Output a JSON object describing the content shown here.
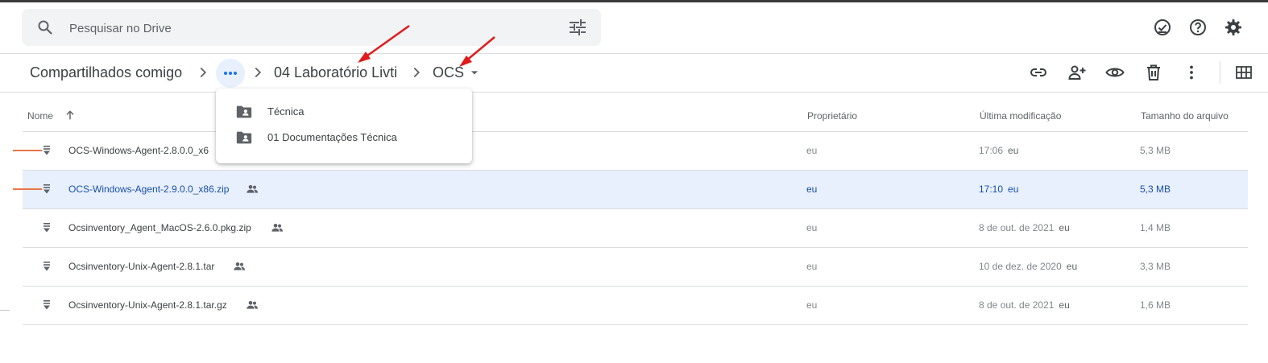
{
  "search": {
    "placeholder": "Pesquisar no Drive"
  },
  "top_icons": [
    "offline-status-icon",
    "help-icon",
    "settings-icon"
  ],
  "breadcrumb": {
    "items": [
      "Compartilhados comigo",
      "04 Laboratório Livti",
      "OCS"
    ],
    "more_icon": "more-horiz-icon",
    "dropdown_icon": "arrow-drop-down-icon"
  },
  "toolbar_icons": [
    "link-icon",
    "share-icon",
    "preview-icon",
    "trash-icon",
    "more-vert-icon",
    "grid-view-icon"
  ],
  "popup": {
    "items": [
      {
        "label": "Técnica",
        "icon": "shared-folder-icon"
      },
      {
        "label": "01 Documentações Técnica",
        "icon": "shared-folder-icon"
      }
    ]
  },
  "table": {
    "columns": {
      "name": "Nome",
      "owner": "Proprietário",
      "modified": "Última modificação",
      "size": "Tamanho do arquivo"
    },
    "sort_icon": "arrow-up-icon",
    "rows": [
      {
        "name": "OCS-Windows-Agent-2.8.0.0_x6",
        "owner": "eu",
        "modified": "17:06",
        "modified_by": "eu",
        "size": "5,3 MB",
        "selected": false,
        "shared": false
      },
      {
        "name": "OCS-Windows-Agent-2.9.0.0_x86.zip",
        "owner": "eu",
        "modified": "17:10",
        "modified_by": "eu",
        "size": "5,3 MB",
        "selected": true,
        "shared": true
      },
      {
        "name": "Ocsinventory_Agent_MacOS-2.6.0.pkg.zip",
        "owner": "eu",
        "modified": "8 de out. de 2021",
        "modified_by": "eu",
        "size": "1,4 MB",
        "selected": false,
        "shared": true
      },
      {
        "name": "Ocsinventory-Unix-Agent-2.8.1.tar",
        "owner": "eu",
        "modified": "10 de dez. de 2020",
        "modified_by": "eu",
        "size": "3,3 MB",
        "selected": false,
        "shared": true
      },
      {
        "name": "Ocsinventory-Unix-Agent-2.8.1.tar.gz",
        "owner": "eu",
        "modified": "8 de out. de 2021",
        "modified_by": "eu",
        "size": "1,6 MB",
        "selected": false,
        "shared": true
      }
    ]
  },
  "colors": {
    "selected_row": "#e8f0fe",
    "accent": "#1a73e8",
    "annotation_arrow": "#e01b1b",
    "row_marker": "#e8754a"
  }
}
